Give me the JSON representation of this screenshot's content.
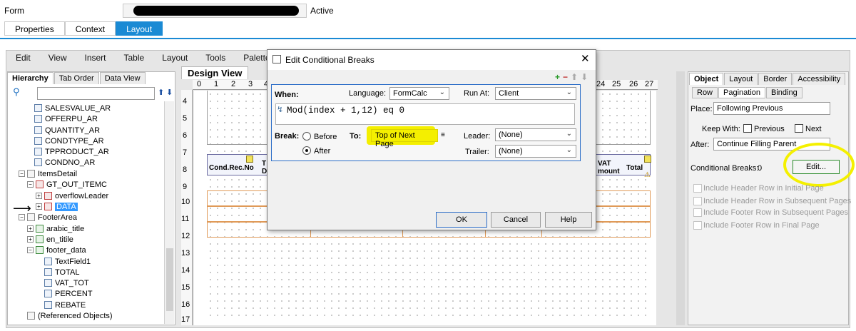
{
  "form": {
    "label": "Form",
    "status": "Active"
  },
  "form_tabs": [
    "Properties",
    "Context",
    "Layout"
  ],
  "menu": [
    "Edit",
    "View",
    "Insert",
    "Table",
    "Layout",
    "Tools",
    "Palettes"
  ],
  "hierarchy": {
    "tabs": [
      "Hierarchy",
      "Tab Order",
      "Data View"
    ],
    "items": [
      "SALESVALUE_AR",
      "OFFERPU_AR",
      "QUANTITY_AR",
      "CONDTYPE_AR",
      "TPPRODUCT_AR",
      "CONDNO_AR",
      "ItemsDetail",
      "GT_OUT_ITEMC",
      "overflowLeader",
      "DATA",
      "FooterArea",
      "arabic_title",
      "en_titile",
      "footer_data",
      "TextField1",
      "TOTAL",
      "VAT_TOT",
      "PERCENT",
      "REBATE",
      "(Referenced Objects)"
    ]
  },
  "design_view": {
    "tab_label": "Design View",
    "ruler_top": [
      "0",
      "1",
      "2",
      "3",
      "4",
      "24",
      "25",
      "26",
      "27"
    ],
    "ruler_left": [
      "4",
      "5",
      "6",
      "7",
      "8",
      "9",
      "10",
      "11",
      "12",
      "13",
      "14",
      "15",
      "16",
      "17"
    ],
    "header_cells": {
      "first": "Cond.Rec.No",
      "vat_top": "VAT",
      "vat_bottom": "mount",
      "total": "Total",
      "partial_top": "T",
      "partial_bottom": "D"
    }
  },
  "dialog": {
    "title": "Edit Conditional Breaks",
    "when_label": "When:",
    "language_label": "Language:",
    "language_value": "FormCalc",
    "run_at_label": "Run At:",
    "run_at_value": "Client",
    "script": "Mod(index + 1,12) eq 0",
    "break_label": "Break:",
    "before_label": "Before",
    "after_label": "After",
    "to_label": "To:",
    "to_value": "Top of Next Page",
    "leader_label": "Leader:",
    "leader_value": "(None)",
    "trailer_label": "Trailer:",
    "trailer_value": "(None)",
    "ok_label": "OK",
    "cancel_label": "Cancel",
    "help_label": "Help"
  },
  "object_panel": {
    "tabs": [
      "Object",
      "Layout",
      "Border",
      "Accessibility"
    ],
    "subtabs": [
      "Row",
      "Pagination",
      "Binding"
    ],
    "place_label": "Place:",
    "place_value": "Following Previous",
    "keep_with_label": "Keep With:",
    "previous_label": "Previous",
    "next_label": "Next",
    "after_label": "After:",
    "after_value": "Continue Filling Parent",
    "conditional_breaks_label": "Conditional Breaks:",
    "conditional_breaks_count": "0",
    "edit_button": "Edit...",
    "options": [
      "Include Header Row in Initial Page",
      "Include Header Row in Subsequent Pages",
      "Include Footer Row in Subsequent Pages",
      "Include Footer Row in Final Page"
    ]
  },
  "colors": {
    "accent": "#1a8ad4",
    "highlight": "#f4ef00",
    "selection": "#3399ff"
  }
}
